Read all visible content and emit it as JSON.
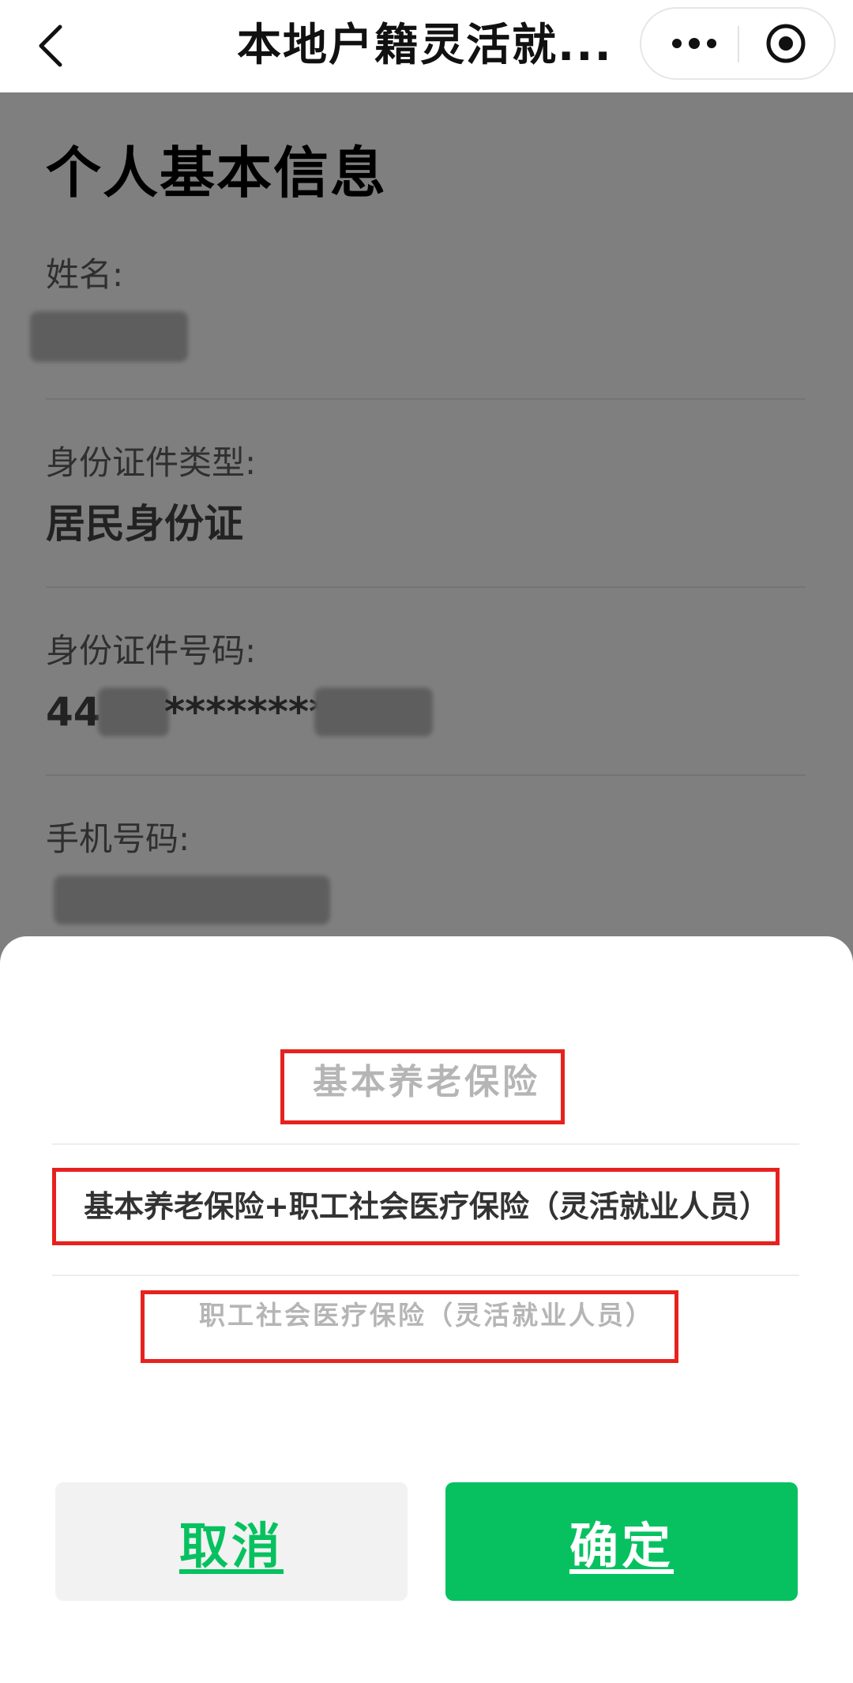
{
  "nav": {
    "title": "本地户籍灵活就...",
    "back_icon": "chevron-left-icon",
    "more_icon": "more-dots-icon",
    "target_icon": "target-circle-icon"
  },
  "form": {
    "section_title": "个人基本信息",
    "fields": [
      {
        "label": "姓名:",
        "value": ""
      },
      {
        "label": "身份证件类型:",
        "value": "居民身份证"
      },
      {
        "label": "身份证件号码:",
        "value_prefix": "44",
        "value_masked": "********"
      },
      {
        "label": "手机号码:",
        "value": ""
      }
    ]
  },
  "sheet": {
    "options": [
      "基本养老保险",
      "基本养老保险+职工社会医疗保险（灵活就业人员）",
      "职工社会医疗保险（灵活就业人员）"
    ],
    "cancel_label": "取消",
    "confirm_label": "确定"
  },
  "colors": {
    "accent": "#07c160",
    "highlight": "#e6221e",
    "mask": "rgba(0,0,0,0.5)"
  }
}
